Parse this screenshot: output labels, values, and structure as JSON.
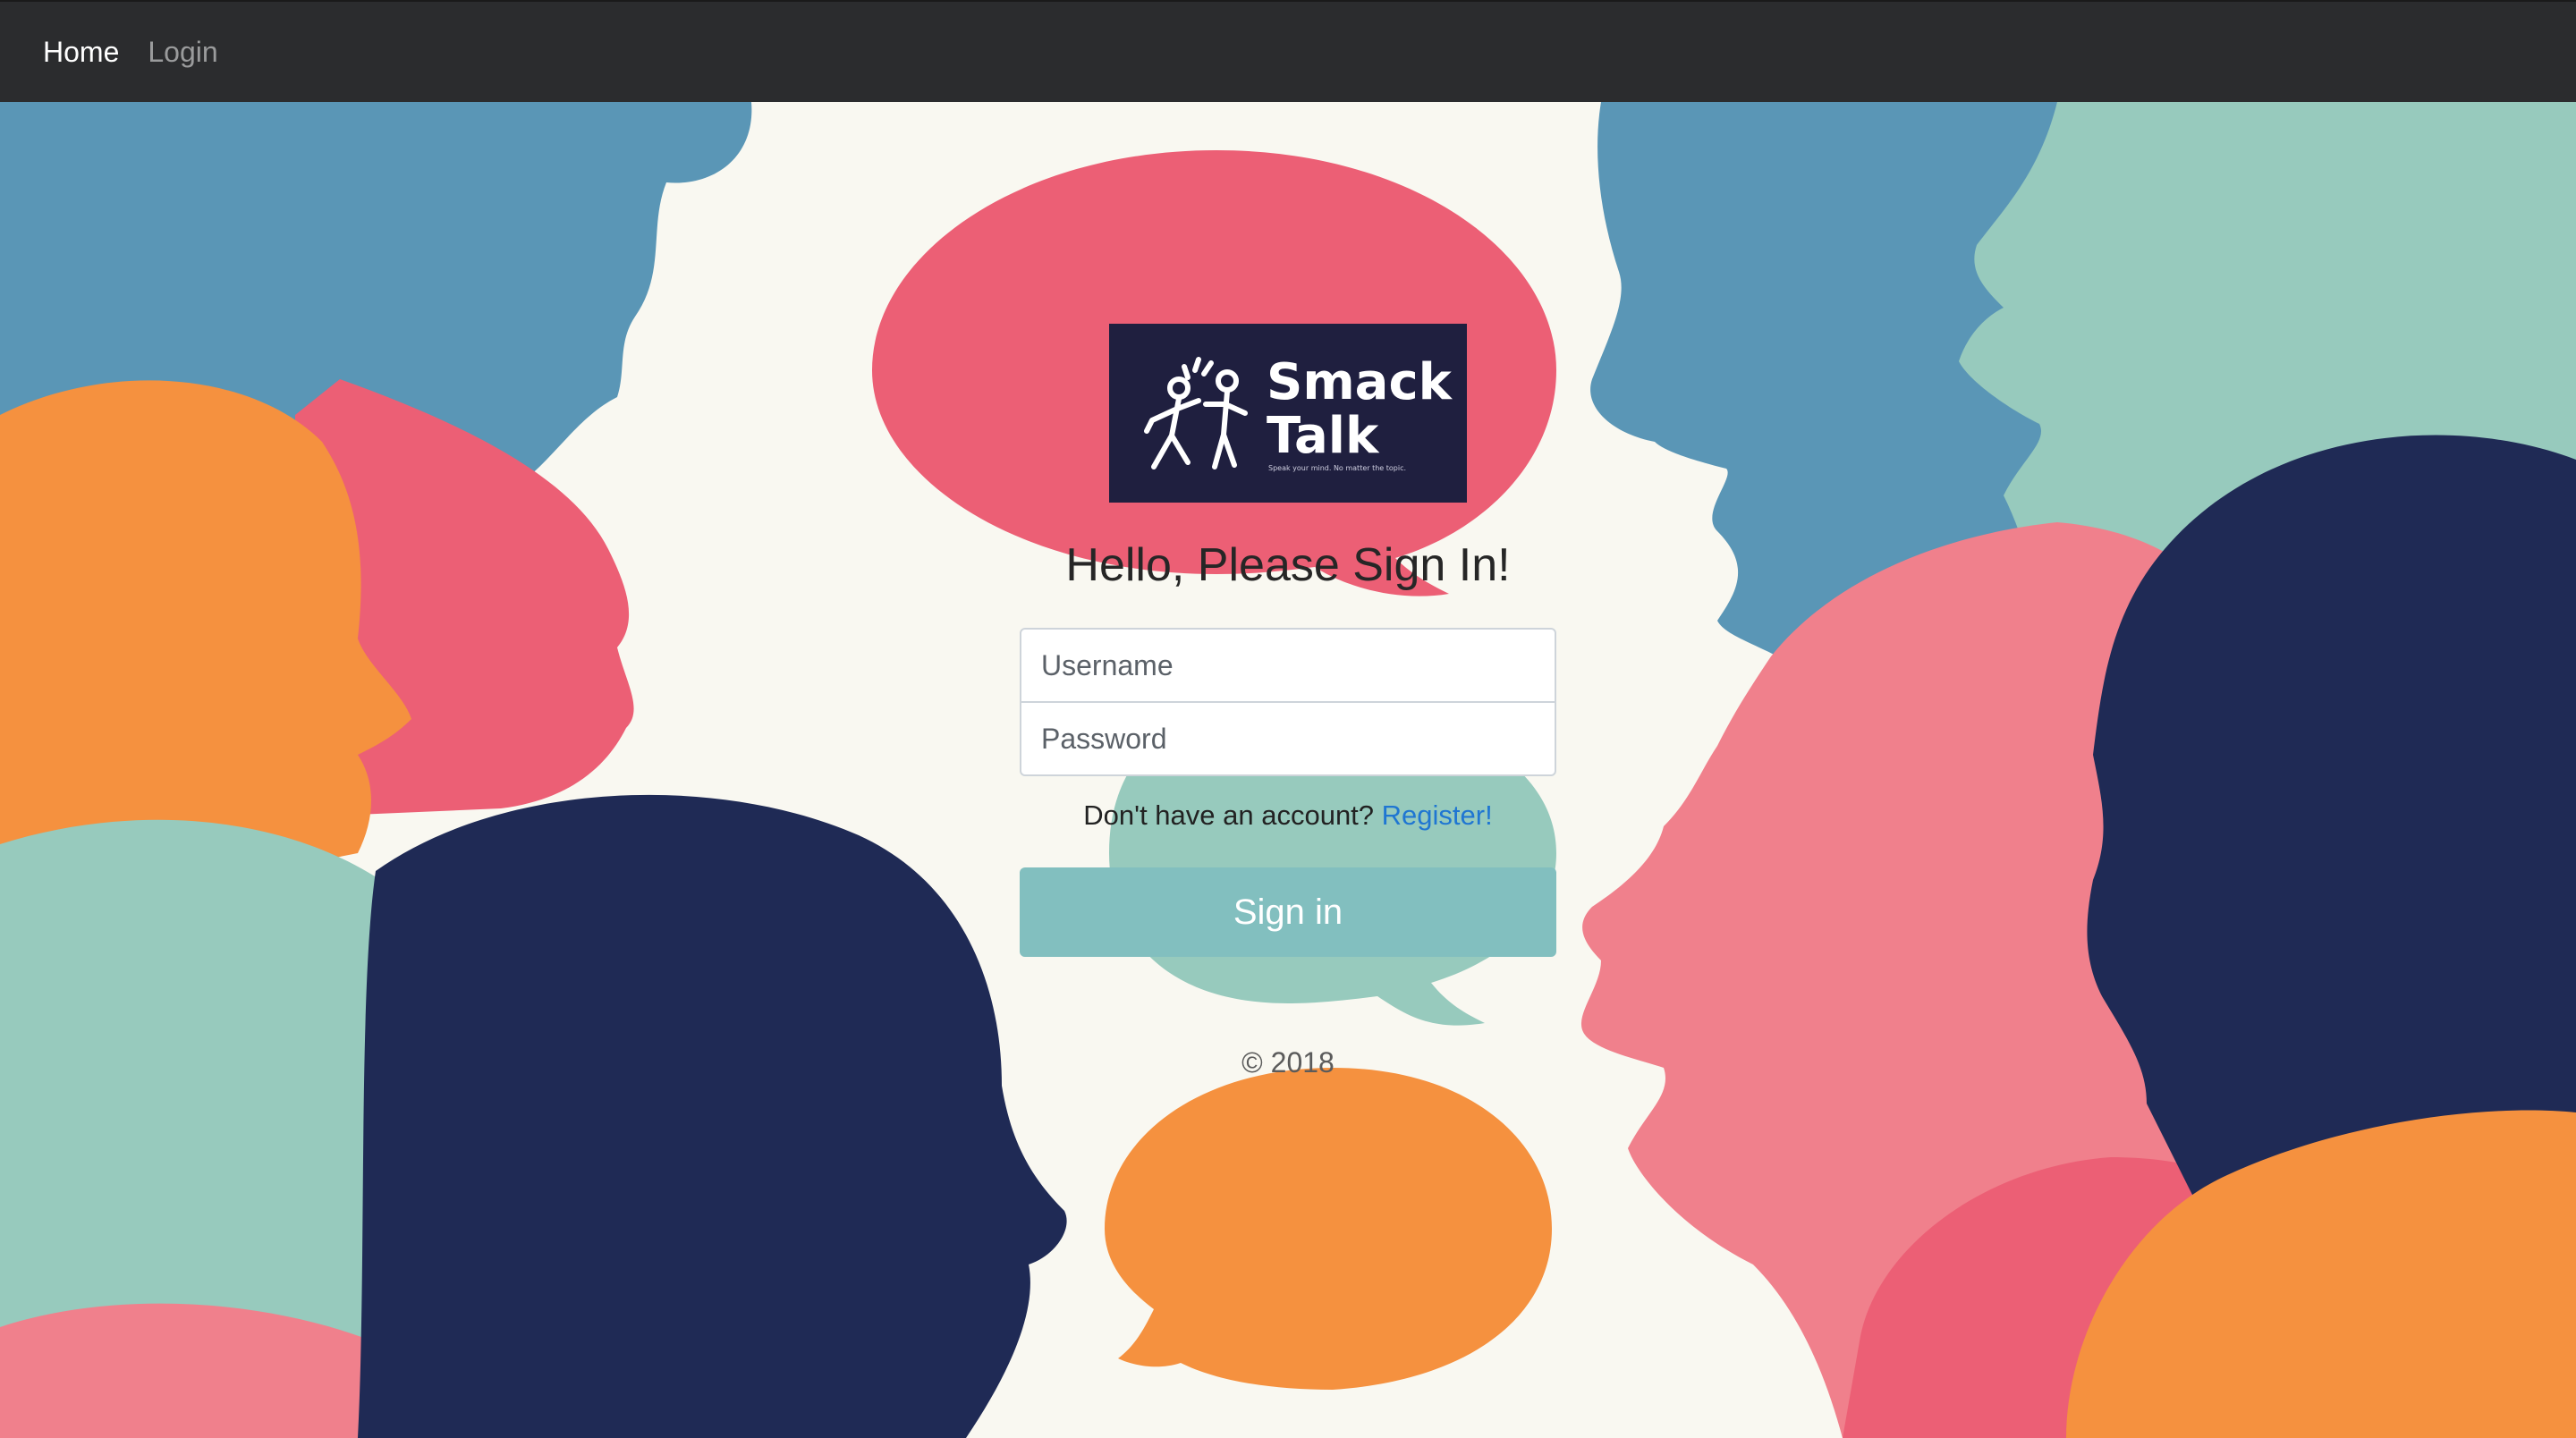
{
  "nav": {
    "home_label": "Home",
    "login_label": "Login"
  },
  "logo": {
    "line1": "Smack",
    "line2": "Talk",
    "tagline": "Speak your mind. No matter the topic."
  },
  "form": {
    "heading": "Hello, Please Sign In!",
    "username_placeholder": "Username",
    "password_placeholder": "Password",
    "register_prompt": "Don't have an account?",
    "register_link": "Register!",
    "submit_label": "Sign in"
  },
  "footer": {
    "copyright": "© 2018"
  },
  "colors": {
    "navbar": "#2b2c2e",
    "background": "#f9f8f1",
    "steel_blue": "#5a96b6",
    "teal": "#97cabd",
    "coral": "#ec5f75",
    "pink": "#f0808c",
    "orange": "#f5913f",
    "navy": "#1f2a55",
    "button": "#82bfbf",
    "link": "#1f76d2"
  }
}
